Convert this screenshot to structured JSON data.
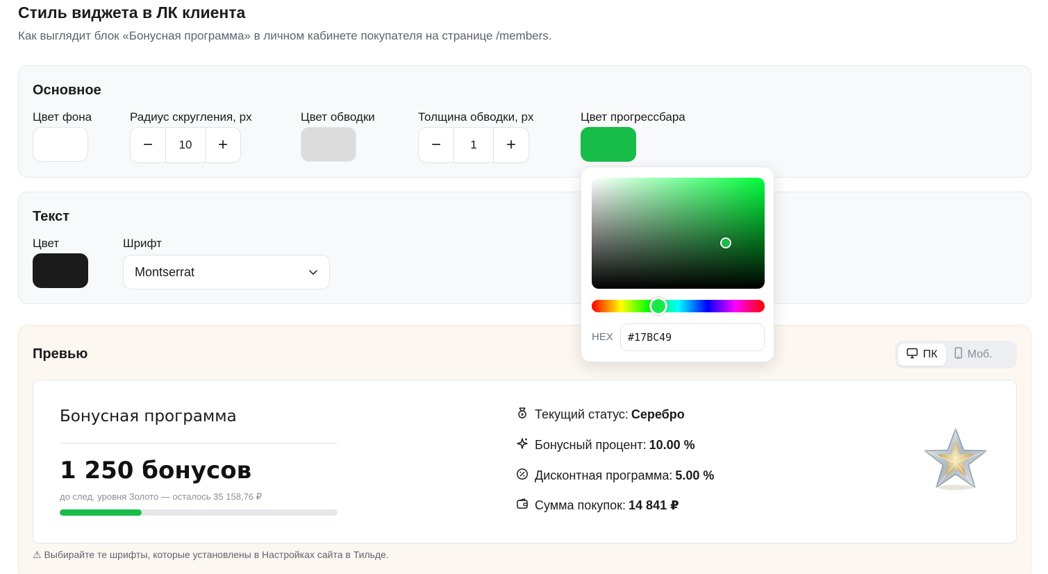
{
  "header": {
    "title": "Стиль виджета в ЛК клиента",
    "subtitle": "Как выглядит блок «Бонусная программа» в личном кабинете покупателя на странице /members."
  },
  "basic": {
    "title": "Основное",
    "bg_color_label": "Цвет фона",
    "bg_color": "#ffffff",
    "radius_label": "Радиус скругления, px",
    "radius_value": "10",
    "border_color_label": "Цвет обводки",
    "border_color": "#dcdcdc",
    "border_width_label": "Толщина обводки, px",
    "border_width_value": "1",
    "progress_color_label": "Цвет прогрессбара",
    "progress_color": "#17bc49",
    "minus": "−",
    "plus": "+"
  },
  "text": {
    "title": "Текст",
    "color_label": "Цвет",
    "color": "#1b1b1b",
    "font_label": "Шрифт",
    "font_value": "Montserrat"
  },
  "picker": {
    "hex_label": "HEX",
    "hex_value": "#17BC49"
  },
  "preview": {
    "title": "Превью",
    "toggle_desktop": "ПК",
    "toggle_mobile": "Моб.",
    "widget": {
      "title": "Бонусная программа",
      "amount": "1 250 бонусов",
      "next_level": "до след. уровня Золото — осталось 35 158,76 ₽",
      "progress_fraction": 0.295,
      "stats": [
        {
          "label": "Текущий статус:",
          "value": "Серебро",
          "icon": "medal-icon"
        },
        {
          "label": "Бонусный процент:",
          "value": "10.00 %",
          "icon": "sparkle-icon"
        },
        {
          "label": "Дисконтная программа:",
          "value": "5.00 %",
          "icon": "discount-icon"
        },
        {
          "label": "Сумма покупок:",
          "value": "14 841 ₽",
          "icon": "wallet-icon"
        }
      ]
    },
    "note": "⚠ Выбирайте те шрифты, которые установлены в Настройках сайта в Тильде."
  }
}
